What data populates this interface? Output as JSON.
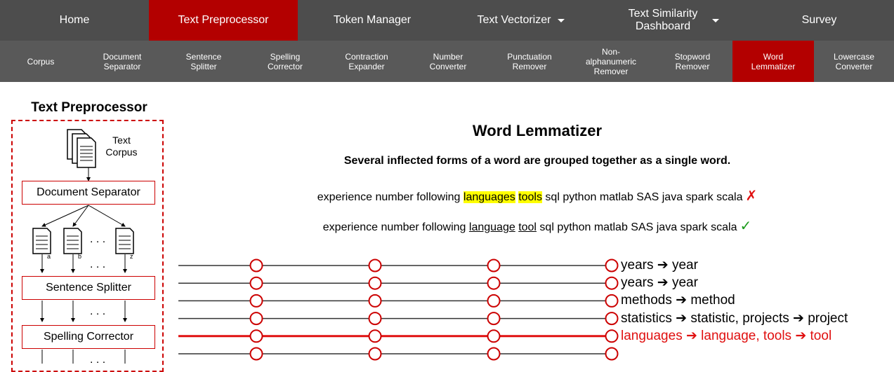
{
  "topnav": {
    "tabs": [
      {
        "label": "Home"
      },
      {
        "label": "Text Preprocessor"
      },
      {
        "label": "Token Manager"
      },
      {
        "label": "Text Vectorizer"
      },
      {
        "label": "Text Similarity Dashboard"
      },
      {
        "label": "Survey"
      }
    ],
    "active": "Text Preprocessor"
  },
  "subnav": {
    "items": [
      {
        "label": "Corpus"
      },
      {
        "label": "Document Separator"
      },
      {
        "label": "Sentence Splitter"
      },
      {
        "label": "Spelling Corrector"
      },
      {
        "label": "Contraction Expander"
      },
      {
        "label": "Number Converter"
      },
      {
        "label": "Punctuation Remover"
      },
      {
        "label": "Non-alphanumeric Remover"
      },
      {
        "label": "Stopword Remover"
      },
      {
        "label": "Word Lemmatizer"
      },
      {
        "label": "Lowercase Converter"
      }
    ],
    "active": "Word Lemmatizer"
  },
  "diagram": {
    "title": "Text Preprocessor",
    "corpus_label": "Text Corpus",
    "boxes": [
      "Document Separator",
      "Sentence Splitter",
      "Spelling Corrector"
    ],
    "doc_labels": [
      "a",
      "b",
      "z"
    ],
    "ellipsis": ". . ."
  },
  "main": {
    "title": "Word Lemmatizer",
    "subtitle": "Several inflected forms of a word are grouped together as a single word.",
    "example_before": {
      "prefix": "experience number following ",
      "highlight1": "languages",
      "highlight2": "tools",
      "suffix": " sql python matlab SAS java spark scala",
      "mark": "✗"
    },
    "example_after": {
      "prefix": "experience number following ",
      "underline1": "language",
      "underline2": "tool",
      "suffix": " sql python matlab SAS java spark scala",
      "mark": "✓"
    }
  },
  "lanes": {
    "items": [
      {
        "label": "years ➔ year"
      },
      {
        "label": "years ➔ year"
      },
      {
        "label": "methods ➔ method"
      },
      {
        "label": "statistics ➔ statistic, projects ➔ project"
      },
      {
        "label": "languages ➔ language, tools ➔ tool"
      },
      {
        "label": ""
      }
    ],
    "active_index": 4,
    "active_color": "#e01010",
    "line_color": "#333333"
  },
  "colors": {
    "accent": "#b30000",
    "nav_bg": "#4d4d4d",
    "subnav_bg": "#595959"
  }
}
